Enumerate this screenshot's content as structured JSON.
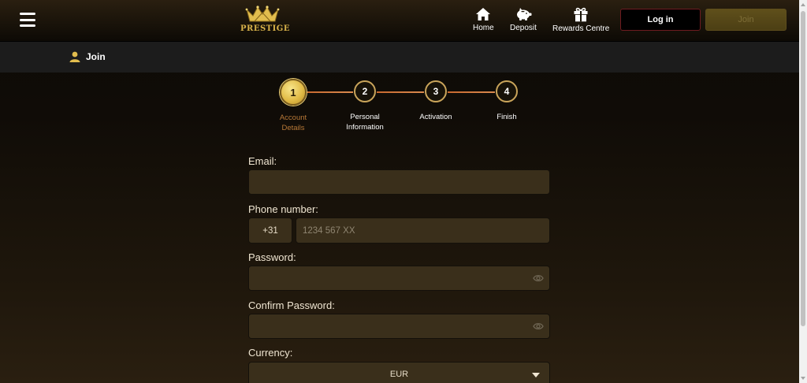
{
  "brand": {
    "name": "PRESTIGE"
  },
  "nav": [
    {
      "label": "Home",
      "icon": "home-icon"
    },
    {
      "label": "Deposit",
      "icon": "piggy-bank-icon"
    },
    {
      "label": "Rewards Centre",
      "icon": "gift-icon"
    }
  ],
  "auth": {
    "login_label": "Log in",
    "join_label": "Join"
  },
  "page": {
    "title": "Join"
  },
  "steps": [
    {
      "number": "1",
      "label_line1": "Account",
      "label_line2": "Details",
      "active": true
    },
    {
      "number": "2",
      "label_line1": "Personal",
      "label_line2": "Information",
      "active": false
    },
    {
      "number": "3",
      "label_line1": "Activation",
      "label_line2": "",
      "active": false
    },
    {
      "number": "4",
      "label_line1": "Finish",
      "label_line2": "",
      "active": false
    }
  ],
  "form": {
    "email_label": "Email:",
    "email_value": "",
    "phone_label": "Phone number:",
    "phone_prefix": "+31",
    "phone_placeholder": "1234 567 XX",
    "password_label": "Password:",
    "password_value": "",
    "confirm_password_label": "Confirm Password:",
    "confirm_password_value": "",
    "currency_label": "Currency:",
    "currency_value": "EUR"
  },
  "colors": {
    "accent_gold": "#d8b24a",
    "active_step_label": "#b77837",
    "step_line": "#c7682e",
    "login_border": "#6e1b20",
    "input_bg": "#3a2f1b"
  }
}
